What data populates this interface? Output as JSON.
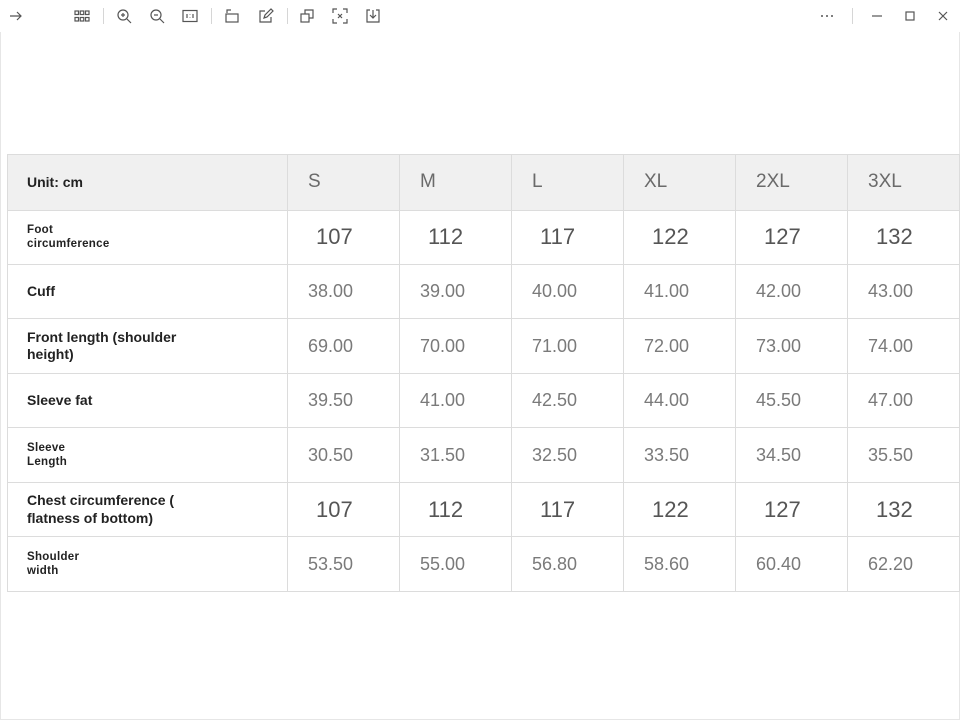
{
  "toolbar": {
    "left_icons": [
      "arrow-right-icon",
      "grid-icon",
      "zoom-in-icon",
      "zoom-out-icon",
      "actual-size-icon",
      "rotate-icon",
      "edit-icon",
      "copy-icon",
      "fit-screen-icon",
      "download-icon"
    ],
    "right_icons": [
      "more-icon",
      "minimize-icon",
      "maximize-icon",
      "close-icon"
    ]
  },
  "table": {
    "unit_label": "Unit: cm",
    "sizes": [
      "S",
      "M",
      "L",
      "XL",
      "2XL",
      "3XL"
    ],
    "rows": [
      {
        "label": "Foot\ncircumference",
        "small": true,
        "int": true,
        "values": [
          "107",
          "112",
          "117",
          "122",
          "127",
          "132"
        ]
      },
      {
        "label": "Cuff",
        "small": false,
        "int": false,
        "values": [
          "38.00",
          "39.00",
          "40.00",
          "41.00",
          "42.00",
          "43.00"
        ]
      },
      {
        "label": "Front length (shoulder\nheight)",
        "small": false,
        "int": false,
        "values": [
          "69.00",
          "70.00",
          "71.00",
          "72.00",
          "73.00",
          "74.00"
        ]
      },
      {
        "label": "Sleeve fat",
        "small": false,
        "int": false,
        "values": [
          "39.50",
          "41.00",
          "42.50",
          "44.00",
          "45.50",
          "47.00"
        ]
      },
      {
        "label": "Sleeve\nLength",
        "small": true,
        "int": false,
        "values": [
          "30.50",
          "31.50",
          "32.50",
          "33.50",
          "34.50",
          "35.50"
        ]
      },
      {
        "label": "Chest circumference (\nflatness of bottom)",
        "small": false,
        "int": true,
        "values": [
          "107",
          "112",
          "117",
          "122",
          "127",
          "132"
        ]
      },
      {
        "label": "Shoulder\nwidth",
        "small": true,
        "int": false,
        "values": [
          "53.50",
          "55.00",
          "56.80",
          "58.60",
          "60.40",
          "62.20"
        ]
      }
    ]
  }
}
